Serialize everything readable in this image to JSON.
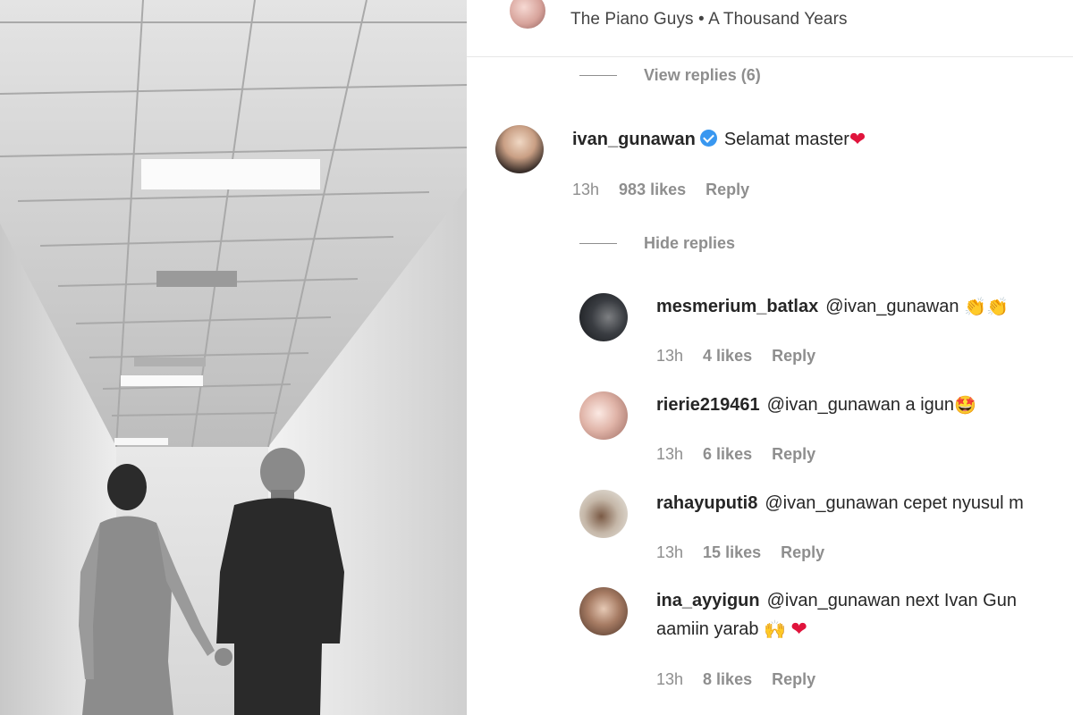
{
  "post_header": {
    "music": "The Piano Guys • A Thousand Years"
  },
  "toggles": {
    "view_replies": "View replies (6)",
    "hide_replies": "Hide replies"
  },
  "comments": [
    {
      "user": "ivan_gunawan",
      "verified": true,
      "text": "Selamat master",
      "emoji": "❤",
      "time": "13h",
      "likes": "983 likes",
      "reply": "Reply"
    },
    {
      "user": "mesmerium_batlax",
      "text": "@ivan_gunawan",
      "emoji": "👏👏",
      "time": "13h",
      "likes": "4 likes",
      "reply": "Reply"
    },
    {
      "user": "rierie219461",
      "text": "@ivan_gunawan a igun",
      "emoji": "🤩",
      "time": "13h",
      "likes": "6 likes",
      "reply": "Reply"
    },
    {
      "user": "rahayuputi8",
      "text": "@ivan_gunawan cepet nyusul m",
      "time": "13h",
      "likes": "15 likes",
      "reply": "Reply"
    },
    {
      "user": "ina_ayyigun",
      "text": "@ivan_gunawan next Ivan Gun",
      "text_line2": "aamiin yarab",
      "emoji": "🙌",
      "emoji2": "❤",
      "time": "13h",
      "likes": "8 likes",
      "reply": "Reply"
    }
  ]
}
